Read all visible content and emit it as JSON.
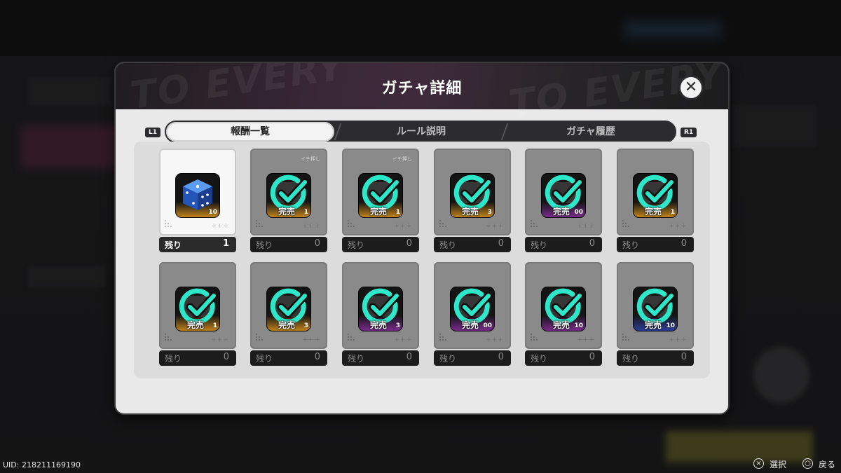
{
  "modal": {
    "title": "ガチャ詳細",
    "close_icon": "close-icon",
    "deco_text": "TO EVERY"
  },
  "tabs": [
    {
      "label": "報酬一覧",
      "active": true
    },
    {
      "label": "ルール説明",
      "active": false
    },
    {
      "label": "ガチャ履歴",
      "active": false
    }
  ],
  "shoulder": {
    "left": "L1",
    "right": "R1"
  },
  "remaining_label": "残り",
  "soldout_label": "完売",
  "pickup_label": "イチ押し",
  "rewards": [
    {
      "remaining": "1",
      "soldout": false,
      "qty": "10",
      "rarity": "gold",
      "icon": "dice-icon",
      "pickup": false
    },
    {
      "remaining": "0",
      "soldout": true,
      "qty": "1",
      "rarity": "gold",
      "icon": "item-icon",
      "pickup": true
    },
    {
      "remaining": "0",
      "soldout": true,
      "qty": "1",
      "rarity": "gold",
      "icon": "item-icon",
      "pickup": true
    },
    {
      "remaining": "0",
      "soldout": true,
      "qty": "3",
      "rarity": "gold",
      "icon": "item-icon",
      "pickup": false
    },
    {
      "remaining": "0",
      "soldout": true,
      "qty": "00",
      "rarity": "purple",
      "icon": "item-icon",
      "pickup": false
    },
    {
      "remaining": "0",
      "soldout": true,
      "qty": "1",
      "rarity": "gold",
      "icon": "item-icon",
      "pickup": false
    },
    {
      "remaining": "0",
      "soldout": true,
      "qty": "1",
      "rarity": "gold",
      "icon": "item-icon",
      "pickup": false
    },
    {
      "remaining": "0",
      "soldout": true,
      "qty": "3",
      "rarity": "gold",
      "icon": "item-icon",
      "pickup": false
    },
    {
      "remaining": "0",
      "soldout": true,
      "qty": "3",
      "rarity": "purple",
      "icon": "item-icon",
      "pickup": false
    },
    {
      "remaining": "0",
      "soldout": true,
      "qty": "00",
      "rarity": "purple",
      "icon": "item-icon",
      "pickup": false
    },
    {
      "remaining": "0",
      "soldout": true,
      "qty": "10",
      "rarity": "purple",
      "icon": "item-icon",
      "pickup": false
    },
    {
      "remaining": "0",
      "soldout": true,
      "qty": "10",
      "rarity": "blue",
      "icon": "item-icon",
      "pickup": false
    }
  ],
  "footer": {
    "uid": "UID: 218211169190",
    "select_label": "選択",
    "back_label": "戻る",
    "select_button": "×",
    "back_button": "○"
  },
  "colors": {
    "soldout_check": "#2ee6c8",
    "dice": "#2b6fd6",
    "gold": "#c1831a",
    "purple": "#7a2a8c",
    "blue": "#2d3f9a"
  }
}
